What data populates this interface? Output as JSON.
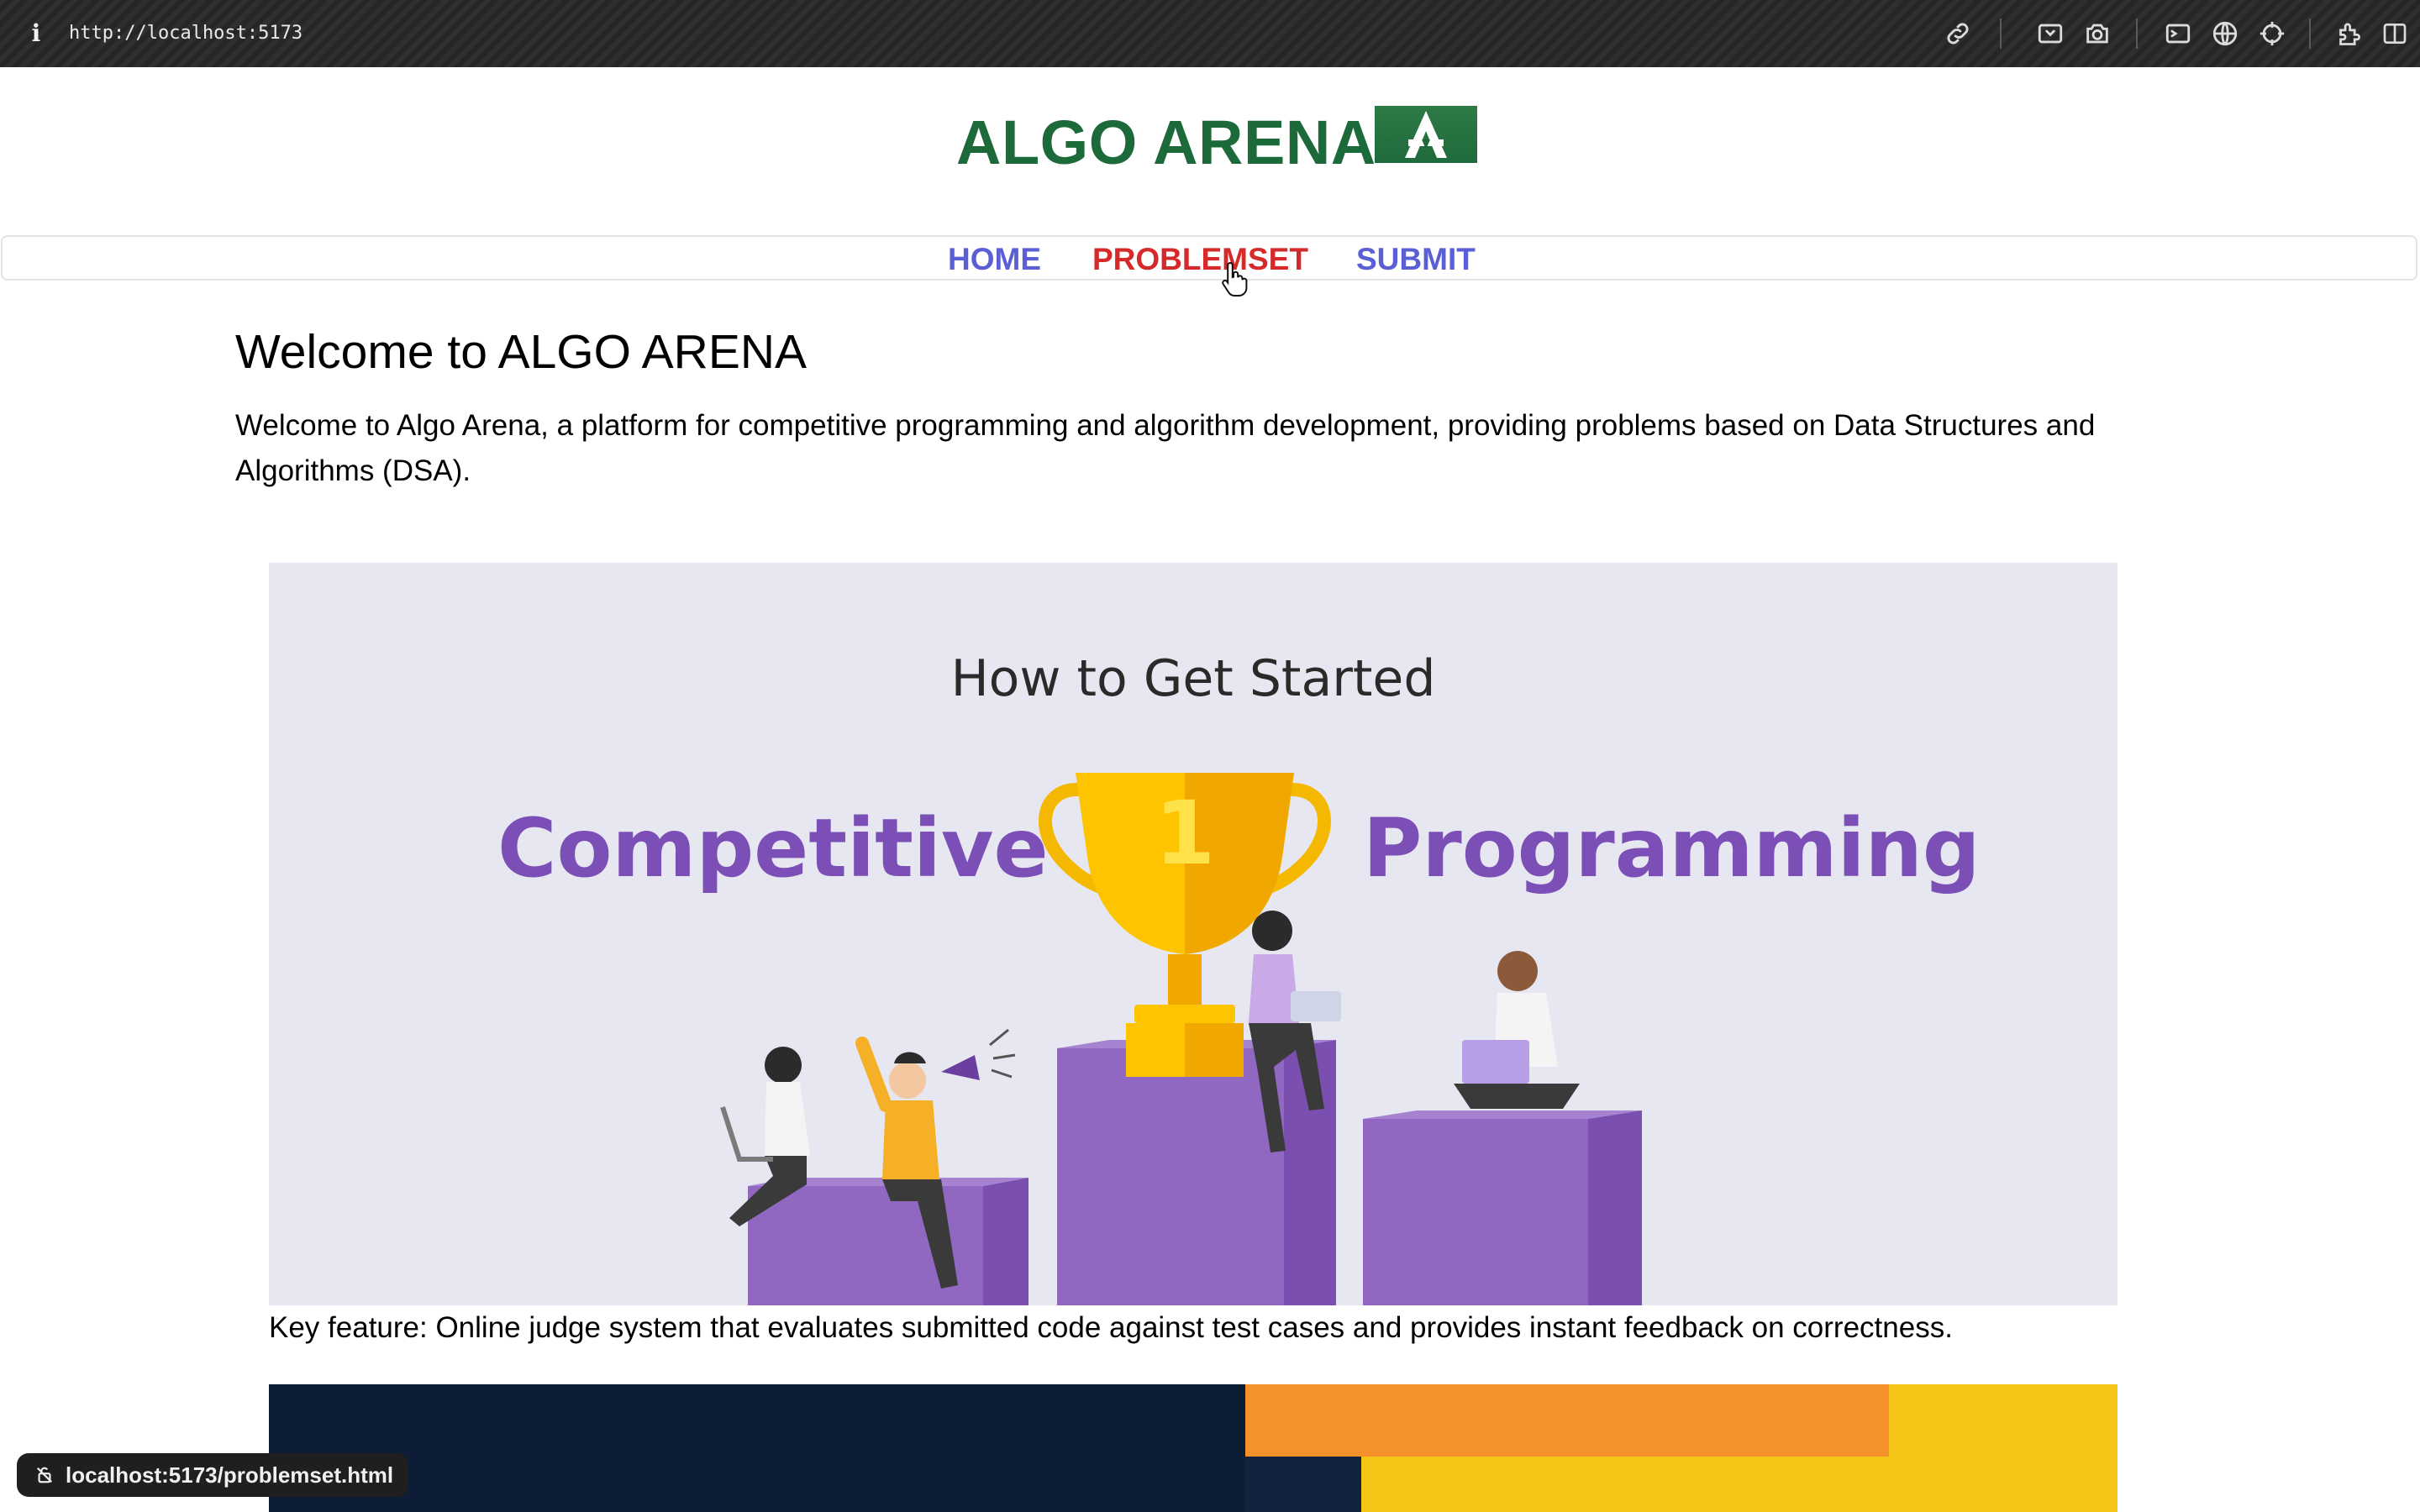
{
  "browser": {
    "url": "http://localhost:5173",
    "icons": [
      "info-icon",
      "link-icon",
      "inspector-icon",
      "camera-icon",
      "terminal-icon",
      "globe-icon",
      "crosshair-icon",
      "extensions-icon",
      "sidebar-icon"
    ]
  },
  "header": {
    "logo_text": "ALGO ARENA",
    "logo_color": "#1c6a3a"
  },
  "nav": {
    "home": "HOME",
    "problemset": "PROBLEMSET",
    "submit": "SUBMIT",
    "link_color": "#5a5fd6",
    "active_color": "#d62a2a"
  },
  "main": {
    "title": "Welcome to ALGO ARENA",
    "intro": "Welcome to Algo Arena, a platform for competitive programming and algorithm development, providing problems based on Data Structures and Algorithms (DSA).",
    "banner": {
      "heading": "How to Get Started",
      "word_left": "Competitive",
      "word_right": "Programming",
      "trophy_number": "1"
    },
    "feature": "Key feature: Online judge system that evaluates submitted code against test cases and provides instant feedback on correctness."
  },
  "status_bar": {
    "hover_url": "localhost:5173/problemset.html"
  }
}
